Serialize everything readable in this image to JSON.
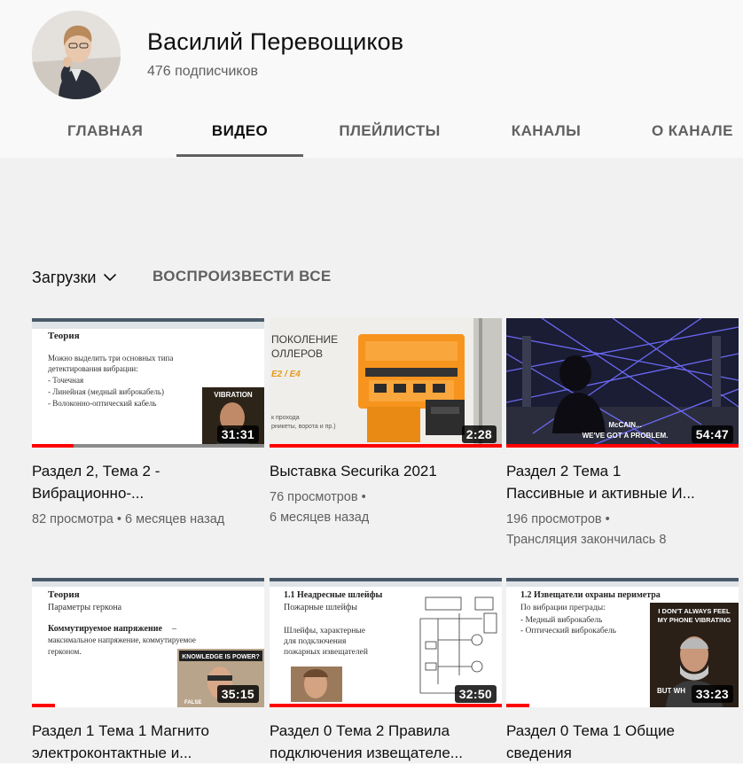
{
  "channel": {
    "name": "Василий Перевощиков",
    "subscribers": "476 подписчиков"
  },
  "tabs": [
    {
      "label": "ГЛАВНАЯ",
      "active": false
    },
    {
      "label": "ВИДЕО",
      "active": true
    },
    {
      "label": "ПЛЕЙЛИСТЫ",
      "active": false
    },
    {
      "label": "КАНАЛЫ",
      "active": false
    },
    {
      "label": "О КАНАЛЕ",
      "active": false
    }
  ],
  "toolbar": {
    "sort_label": "Загрузки",
    "play_all_label": "ВОСПРОИЗВЕСТИ ВСЕ"
  },
  "colors": {
    "progress": "#ff0000",
    "text_primary": "#0f0f0f",
    "text_secondary": "#606060",
    "content_bg": "#f1f1f1"
  },
  "videos": [
    {
      "title_line1": "Раздел 2, Тема 2 -",
      "title_line2": "Вибрационно-...",
      "meta_line1": "82 просмотра • 6 месяцев назад",
      "meta_line2": "",
      "duration": "31:31",
      "watched_fraction": 0.18,
      "thumb": {
        "heading": "Теория",
        "lines": [
          "Можно выделить три основных типа",
          "детектирования вибрации:",
          "-   Точечная",
          "-   Линейная (медный виброкабель)",
          "-   Волоконно-оптический кабель"
        ],
        "meme_caption": "VIBRATION"
      }
    },
    {
      "title_line1": "Выставка Securika 2021",
      "title_line2": "",
      "meta_line1": "76 просмотров •",
      "meta_line2": "6 месяцев назад",
      "duration": "2:28",
      "watched_fraction": 1.0,
      "thumb": {
        "sign_lines": [
          "ПОКОЛЕНИЕ",
          "ОЛЛЕРОВ",
          "E2 / E4"
        ],
        "sign_small": [
          "к прохода",
          "рникеты, ворота и пр.)"
        ]
      }
    },
    {
      "title_line1": "Раздел 2 Тема 1",
      "title_line2": "Пассивные и активные И...",
      "meta_line1": "196 просмотров •",
      "meta_line2": "Трансляция закончилась 8",
      "duration": "54:47",
      "watched_fraction": 1.0,
      "thumb": {
        "caption_line1": "McCAIN...",
        "caption_line2": "WE'VE GOT A PROBLEM."
      }
    },
    {
      "title_line1": "Раздел 1 Тема 1 Магнито",
      "title_line2": "электроконтактные и...",
      "meta_line1": "",
      "meta_line2": "",
      "duration": "35:15",
      "watched_fraction": 0.1,
      "thumb": {
        "heading": "Теория",
        "subheading": "Параметры геркона",
        "bold_term": "Коммутируемое напряжение",
        "lines": [
          "максимальное напряжение, коммутируемое",
          "герконом."
        ],
        "meme_caption": "KNOWLEDGE IS POWER?",
        "meme_footer": "FALSE"
      }
    },
    {
      "title_line1": "Раздел 0 Тема 2 Правила",
      "title_line2": "подключения извещателе...",
      "meta_line1": "",
      "meta_line2": "",
      "duration": "32:50",
      "watched_fraction": 1.0,
      "thumb": {
        "heading": "1.1 Неадресные шлейфы",
        "lines": [
          "Пожарные шлейфы",
          "",
          "Шлейфы, характерные",
          "для подключения",
          "пожарных извещателей"
        ]
      }
    },
    {
      "title_line1": "Раздел 0 Тема 1 Общие",
      "title_line2": "сведения",
      "meta_line1": "",
      "meta_line2": "",
      "duration": "33:23",
      "watched_fraction": 0.1,
      "thumb": {
        "heading": "1.2 Извещатели охраны периметра",
        "lines": [
          "По вибрации преграды:",
          "-   Медный виброкабель",
          "-   Оптический виброкабель"
        ],
        "meme_caption_line1": "I DON'T ALWAYS FEEL",
        "meme_caption_line2": "MY PHONE VIBRATING",
        "meme_footer": "BUT WH"
      }
    }
  ]
}
